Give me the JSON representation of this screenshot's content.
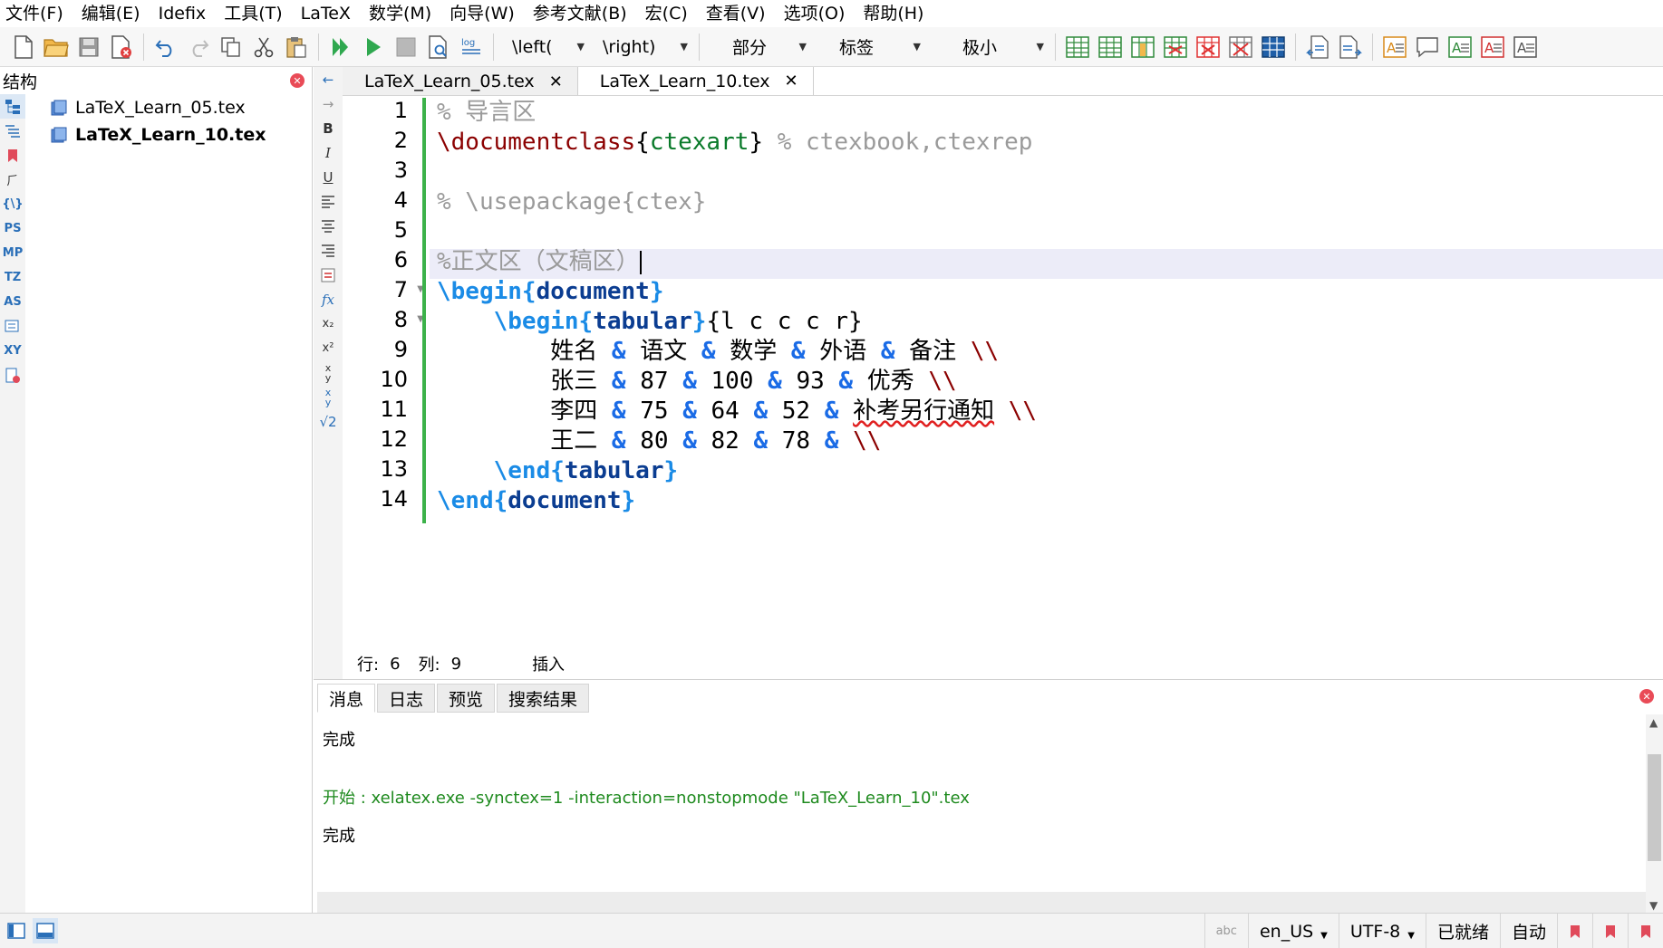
{
  "menubar": {
    "items": [
      "文件(F)",
      "编辑(E)",
      "Idefix",
      "工具(T)",
      "LaTeX",
      "数学(M)",
      "向导(W)",
      "参考文献(B)",
      "宏(C)",
      "查看(V)",
      "选项(O)",
      "帮助(H)"
    ]
  },
  "toolbar": {
    "left_combo": "\\left(",
    "right_combo": "\\right)",
    "section_combo": "部分",
    "label_combo": "标签",
    "size_combo": "极小"
  },
  "structure": {
    "title": "结构",
    "files": [
      {
        "name": "LaTeX_Learn_05.tex",
        "bold": false
      },
      {
        "name": "LaTeX_Learn_10.tex",
        "bold": true
      }
    ],
    "strip_labels": [
      "PS",
      "MP",
      "TZ",
      "AS",
      "XY"
    ]
  },
  "editor": {
    "tabs": [
      {
        "label": "LaTeX_Learn_05.tex",
        "active": false
      },
      {
        "label": "LaTeX_Learn_10.tex",
        "active": true
      }
    ],
    "line_numbers": [
      "1",
      "2",
      "3",
      "4",
      "5",
      "6",
      "7",
      "8",
      "9",
      "10",
      "11",
      "12",
      "13",
      "14"
    ],
    "code": {
      "l1": "% 导言区",
      "l2_cmd": "\\documentclass",
      "l2_arg": "ctexart",
      "l2_comment": "% ctexbook,ctexrep",
      "l4": "% \\usepackage{ctex}",
      "l6": "%正文区（文稿区）",
      "l7_begin": "\\begin",
      "l7_env": "document",
      "l8_begin": "\\begin",
      "l8_env": "tabular",
      "l8_spec": "{l c c c r}",
      "row1": [
        "姓名",
        "语文",
        "数学",
        "外语",
        "备注"
      ],
      "row2": [
        "张三",
        "87",
        "100",
        "93",
        "优秀"
      ],
      "row3": [
        "李四",
        "75",
        "64",
        "52",
        "补考另行通知"
      ],
      "row4": [
        "王二",
        "80",
        "82",
        "78",
        ""
      ],
      "amp": "&",
      "newline": "\\\\",
      "l13_end": "\\end",
      "l13_env": "tabular",
      "l14_end": "\\end",
      "l14_env": "document"
    },
    "status": {
      "row_label": "行:",
      "row": "6",
      "col_label": "列:",
      "col": "9",
      "mode": "插入"
    }
  },
  "messages": {
    "tabs": [
      "消息",
      "日志",
      "预览",
      "搜索结果"
    ],
    "lines": [
      {
        "text": "完成",
        "color": "black"
      },
      {
        "text": "开始 : xelatex.exe -synctex=1 -interaction=nonstopmode \"LaTeX_Learn_10\".tex",
        "color": "green"
      },
      {
        "text": "完成",
        "color": "black"
      }
    ]
  },
  "statusbar": {
    "language": "en_US",
    "encoding": "UTF-8",
    "state": "已就绪",
    "auto": "自动"
  },
  "colors": {
    "accent_blue": "#1a8be6",
    "command_red": "#8b0000",
    "argument_green": "#0a7a2a",
    "gutter_marker": "#3cb24a",
    "message_green": "#1e8a1e"
  }
}
